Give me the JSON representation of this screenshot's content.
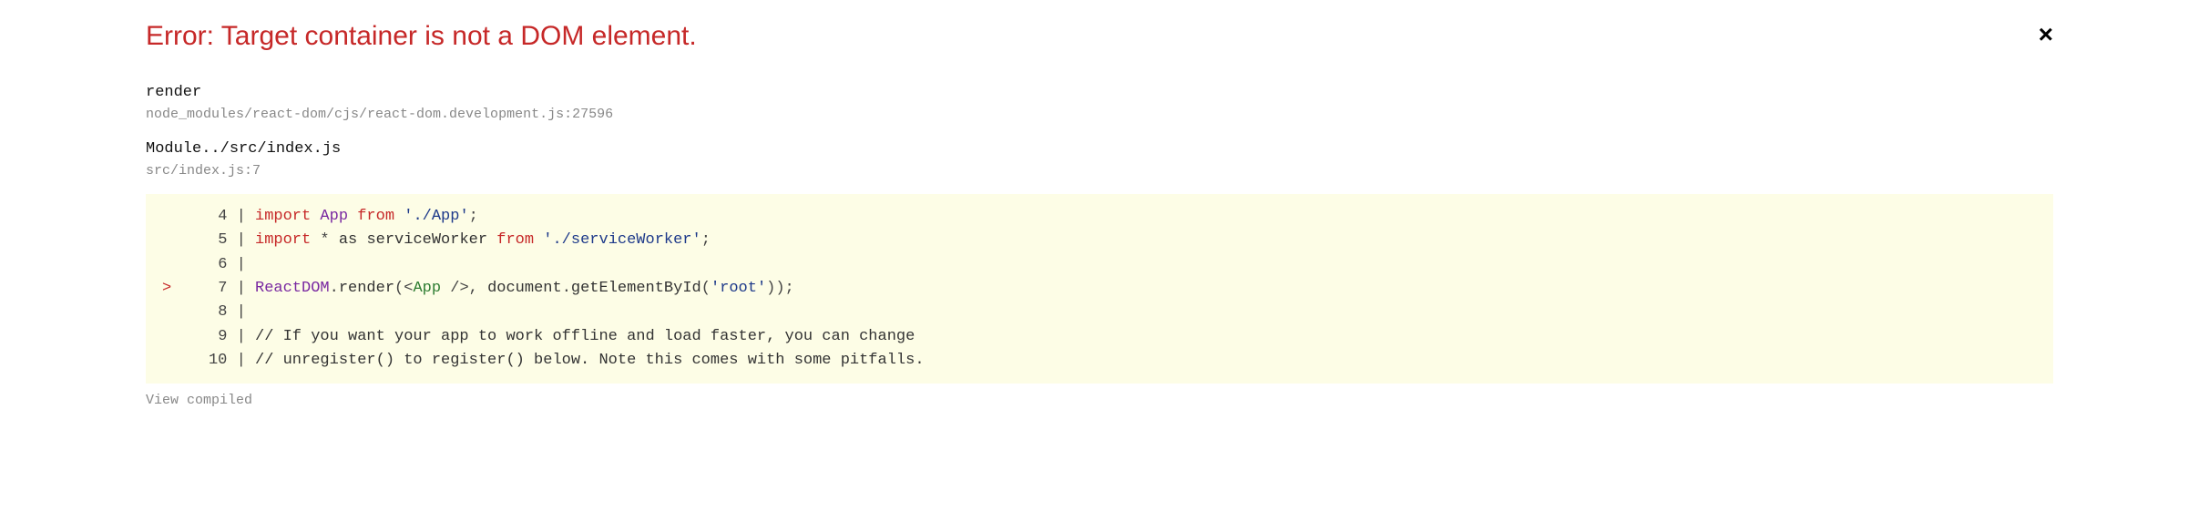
{
  "header": {
    "error_title": "Error: Target container is not a DOM element.",
    "close_glyph": "×"
  },
  "stack": [
    {
      "title": "render",
      "location": "node_modules/react-dom/cjs/react-dom.development.js:27596"
    },
    {
      "title": "Module../src/index.js",
      "location": "src/index.js:7"
    }
  ],
  "code": {
    "lines": [
      {
        "num": "4",
        "caret": " ",
        "tokens": [
          {
            "t": "import",
            "c": "tok-keyword"
          },
          {
            "t": " "
          },
          {
            "t": "App",
            "c": "tok-purple"
          },
          {
            "t": " "
          },
          {
            "t": "from",
            "c": "tok-keyword"
          },
          {
            "t": " "
          },
          {
            "t": "'./App'",
            "c": "tok-blue"
          },
          {
            "t": ";",
            "c": "tok-gray"
          }
        ]
      },
      {
        "num": "5",
        "caret": " ",
        "tokens": [
          {
            "t": "import",
            "c": "tok-keyword"
          },
          {
            "t": " "
          },
          {
            "t": "*",
            "c": "tok-gray"
          },
          {
            "t": " "
          },
          {
            "t": "as",
            "c": "tok-ident"
          },
          {
            "t": " "
          },
          {
            "t": "serviceWorker",
            "c": "tok-ident"
          },
          {
            "t": " "
          },
          {
            "t": "from",
            "c": "tok-keyword"
          },
          {
            "t": " "
          },
          {
            "t": "'./serviceWorker'",
            "c": "tok-blue"
          },
          {
            "t": ";",
            "c": "tok-gray"
          }
        ]
      },
      {
        "num": "6",
        "caret": " ",
        "tokens": []
      },
      {
        "num": "7",
        "caret": ">",
        "tokens": [
          {
            "t": "ReactDOM",
            "c": "tok-purple"
          },
          {
            "t": ".",
            "c": "tok-gray"
          },
          {
            "t": "render",
            "c": "tok-ident"
          },
          {
            "t": "(",
            "c": "tok-gray"
          },
          {
            "t": "<",
            "c": "tok-gray"
          },
          {
            "t": "App",
            "c": "tok-green"
          },
          {
            "t": " ",
            "c": ""
          },
          {
            "t": "/>",
            "c": "tok-gray"
          },
          {
            "t": ", ",
            "c": "tok-gray"
          },
          {
            "t": "document",
            "c": "tok-ident"
          },
          {
            "t": ".",
            "c": "tok-gray"
          },
          {
            "t": "getElementById",
            "c": "tok-ident"
          },
          {
            "t": "(",
            "c": "tok-gray"
          },
          {
            "t": "'root'",
            "c": "tok-blue"
          },
          {
            "t": "));",
            "c": "tok-gray"
          }
        ]
      },
      {
        "num": "8",
        "caret": " ",
        "tokens": []
      },
      {
        "num": "9",
        "caret": " ",
        "tokens": [
          {
            "t": "// If you want your app to work offline and load faster, you can change",
            "c": "tok-ident"
          }
        ]
      },
      {
        "num": "10",
        "caret": " ",
        "tokens": [
          {
            "t": "// unregister() to register() below. Note this comes with some pitfalls.",
            "c": "tok-ident"
          }
        ]
      }
    ]
  },
  "footer": {
    "view_compiled": "View compiled"
  }
}
